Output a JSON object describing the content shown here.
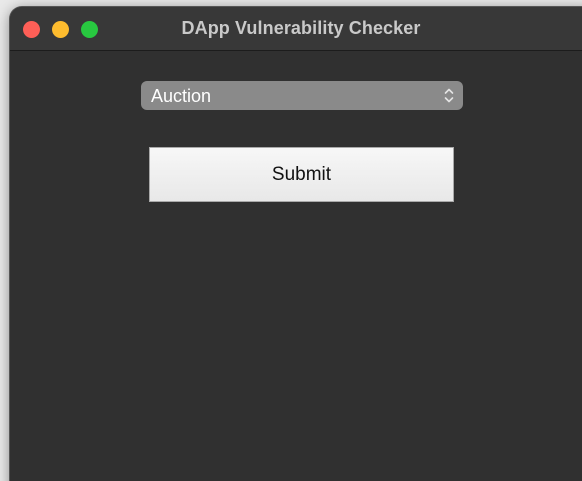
{
  "window": {
    "title": "DApp Vulnerability Checker"
  },
  "form": {
    "contract_type": {
      "selected": "Auction"
    },
    "submit_label": "Submit"
  },
  "colors": {
    "window_bg": "#303030",
    "titlebar_bg": "#383838",
    "close": "#fe5f57",
    "minimize": "#febc2e",
    "zoom": "#28c840",
    "select_bg": "#8a8a8a"
  },
  "icons": {
    "select_arrows": "chevron-up-down-icon"
  }
}
